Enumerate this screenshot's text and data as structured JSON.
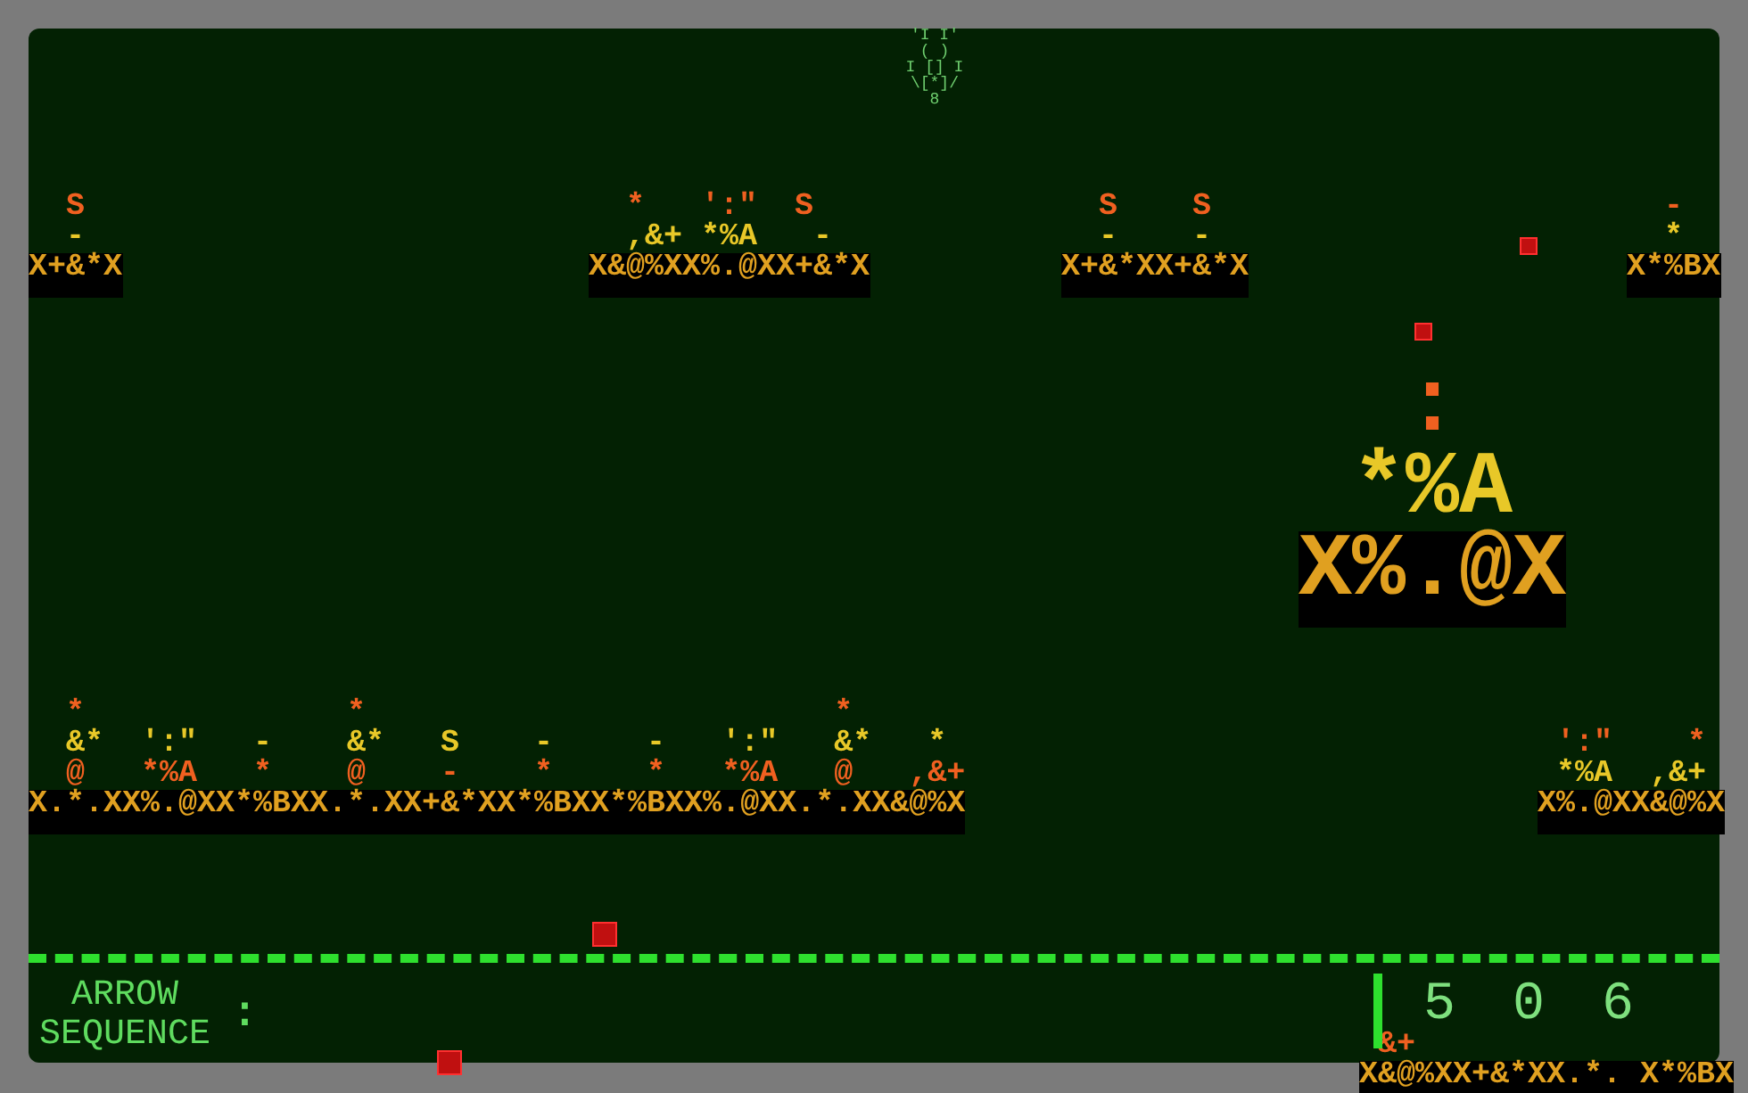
{
  "player": {
    "lines": [
      "'I I'",
      "( )",
      "I [] I",
      "\\[*]/",
      "8"
    ]
  },
  "platforms": [
    {
      "lines": [
        "  S",
        "  -",
        "X+&*X"
      ]
    },
    {
      "lines": [
        "  *   ':\"  S",
        "  ,&+ *%A   -",
        "X&@%XX%.@XX+&*X"
      ]
    },
    {
      "lines": [
        "  S    S",
        "  -    -",
        "X+&*XX+&*X"
      ]
    },
    {
      "lines": [
        "  -",
        "  *",
        "X*%BX"
      ]
    },
    {
      "lines": [
        "  :",
        " *%A",
        "X%.@X"
      ]
    },
    {
      "lines": [
        "  *              *                         *",
        "  &*  ':\"   -    &*   S    -     -   ':\"   &*   *",
        "  @   *%A   *    @    -    *     *   *%A   @   ,&+",
        "X.*.XX%.@XX*%BXX.*.XX+&*XX*%BXX*%BXX%.@XX.*.XX&@%X"
      ]
    },
    {
      "lines": [
        " ':\"    *",
        " *%A  ,&+",
        "X%.@XX&@%X"
      ]
    },
    {
      "lines": [
        " &+",
        "X&@%XX+&*XX.*. X*%BX"
      ]
    }
  ],
  "hud": {
    "label_lines": [
      "ARROW",
      "SEQUENCE"
    ],
    "separator": ":",
    "digits": [
      "5",
      "0",
      "6"
    ]
  }
}
